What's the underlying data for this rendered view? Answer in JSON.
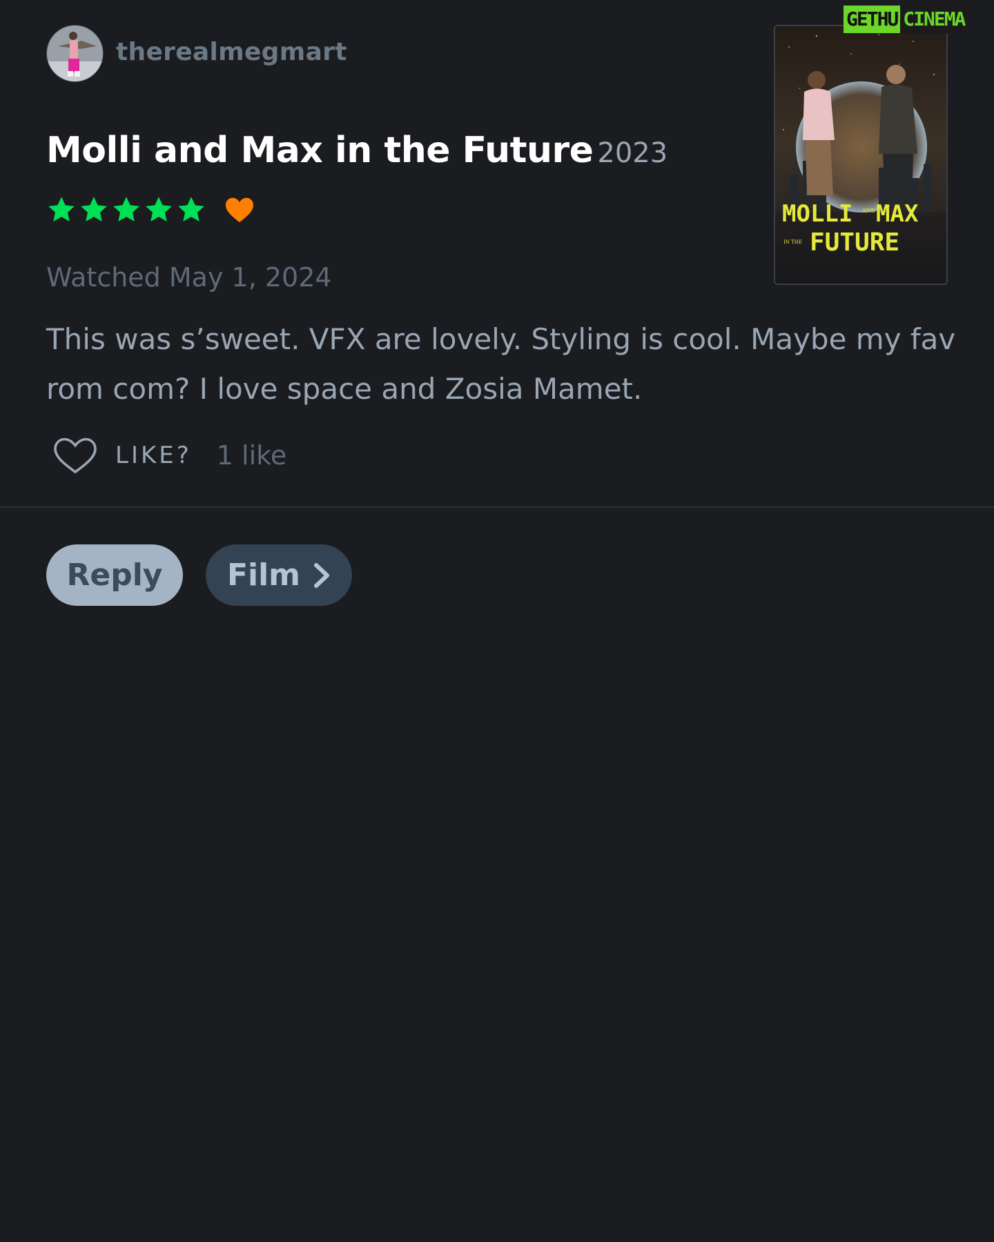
{
  "user": {
    "username": "therealmegmart"
  },
  "film": {
    "title": "Molli and Max in the Future",
    "year": "2023",
    "rating_stars": 5,
    "liked": true
  },
  "review": {
    "watched_label": "Watched May 1, 2024",
    "text": "This was s’sweet. VFX are lovely. Styling is cool. Maybe my fav rom com? I love space and Zosia Mamet.",
    "like_label": "LIKE?",
    "like_count": "1 like"
  },
  "poster": {
    "line1_left": "MOLLI",
    "line1_small": "AND",
    "line1_right": "MAX",
    "line2_small": "IN THE",
    "line2": "FUTURE"
  },
  "actions": {
    "reply_label": "Reply",
    "film_label": "Film"
  },
  "watermark": {
    "part1": "GETHU",
    "part2": "CINEMA"
  },
  "colors": {
    "background": "#1a1c20",
    "star_green": "#00e054",
    "heart_orange": "#ff8000",
    "poster_title_yellow": "#e6e93a"
  },
  "icons": {
    "star": "star-icon",
    "liked": "heart-filled-icon",
    "like": "heart-outline-icon",
    "chevron": "chevron-right-icon"
  }
}
